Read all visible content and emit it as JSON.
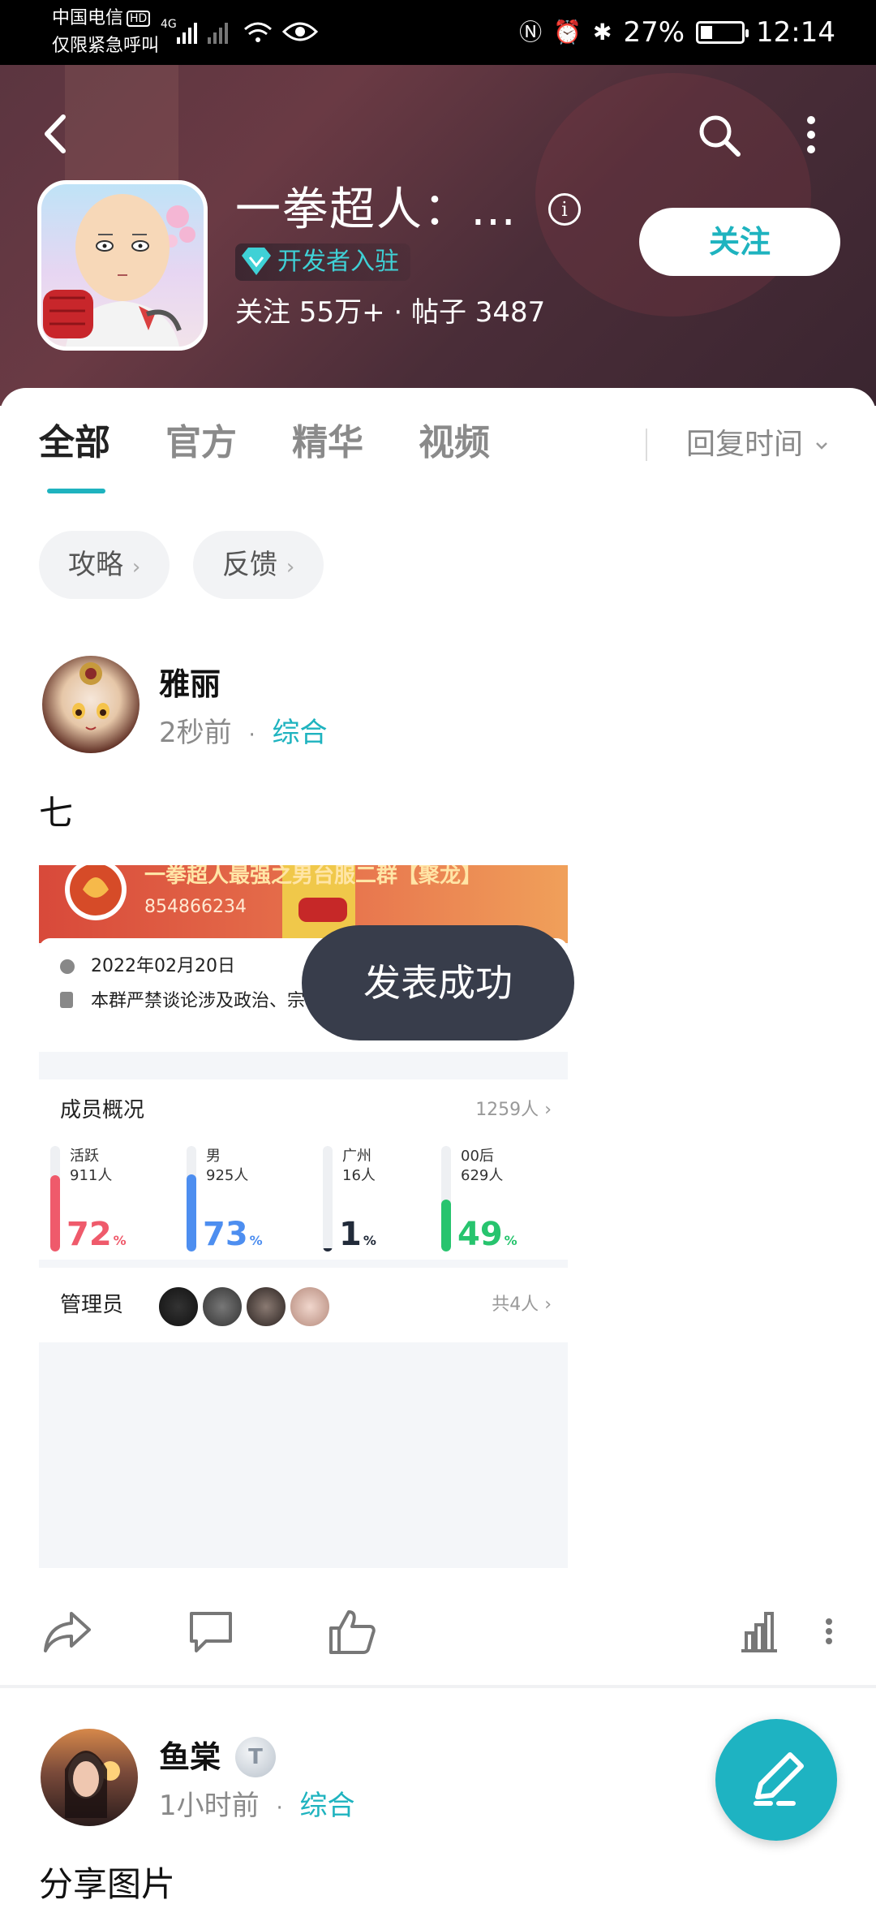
{
  "status_bar": {
    "carrier_line1": "中国电信",
    "carrier_hd": "HD",
    "carrier_line2": "仅限紧急呼叫",
    "network": "4G",
    "battery": "27%",
    "time": "12:14"
  },
  "header": {
    "game_title": "一拳超人：…",
    "developer_tag": "开发者入驻",
    "stats": "关注 55万+ · 帖子 3487",
    "follow_label": "关注"
  },
  "tabs": [
    {
      "label": "全部"
    },
    {
      "label": "官方"
    },
    {
      "label": "精华"
    },
    {
      "label": "视频"
    }
  ],
  "sort_label": "回复时间",
  "chips": [
    {
      "label": "攻略"
    },
    {
      "label": "反馈"
    }
  ],
  "post1": {
    "author": "雅丽",
    "time": "2秒前",
    "dot": "·",
    "category": "综合",
    "title": "七",
    "image": {
      "group_name": "一拳超人最强之男台服二群【聚龙】",
      "group_id": "854866234",
      "date": "2022年02月20日",
      "rules": "本群严禁谈论涉及政治、宗教、色情、暴力等",
      "members_heading": "成员概况",
      "members_count": "1259人",
      "stats": [
        {
          "label": "活跃",
          "count": "911人",
          "percent": "72",
          "unit": "%",
          "color": "#ef5a6b"
        },
        {
          "label": "男",
          "count": "925人",
          "percent": "73",
          "unit": "%",
          "color": "#4d8ef0"
        },
        {
          "label": "广州",
          "count": "16人",
          "percent": "1",
          "unit": "%",
          "color": "#222b3a"
        },
        {
          "label": "00后",
          "count": "629人",
          "percent": "49",
          "unit": "%",
          "color": "#27c46e"
        }
      ],
      "admins_heading": "管理员",
      "admins_count": "共4人"
    }
  },
  "toast": "发表成功",
  "post2": {
    "author": "鱼棠",
    "badge": "T",
    "time": "1小时前",
    "dot": "·",
    "category": "综合",
    "title": "分享图片"
  },
  "colors": {
    "accent": "#1eb3bf",
    "toast_bg": "#383d4b",
    "header_bg": "#5b3540"
  }
}
